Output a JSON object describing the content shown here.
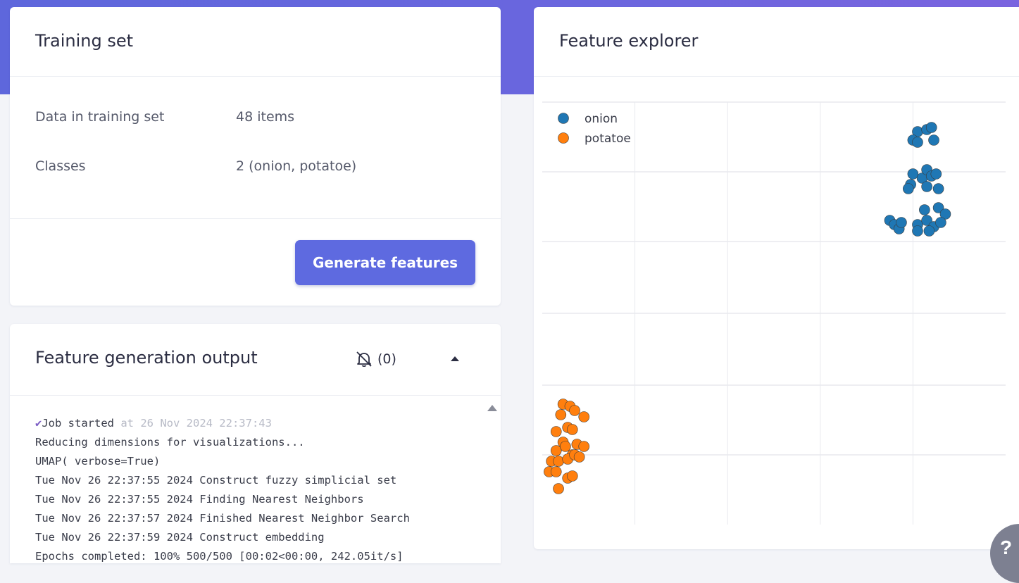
{
  "training": {
    "title": "Training set",
    "rows": [
      {
        "label": "Data in training set",
        "value": "48 items"
      },
      {
        "label": "Classes",
        "value": "2 (onion, potatoe)"
      }
    ],
    "generate_button": "Generate features"
  },
  "output": {
    "title": "Feature generation output",
    "notification_count": "(0)",
    "log": [
      {
        "text": "Job started",
        "time": " at 26 Nov 2024 22:37:43",
        "checked": true
      },
      {
        "text": "Reducing dimensions for visualizations..."
      },
      {
        "text": "UMAP( verbose=True)"
      },
      {
        "text": "Tue Nov 26 22:37:55 2024 Construct fuzzy simplicial set"
      },
      {
        "text": "Tue Nov 26 22:37:55 2024 Finding Nearest Neighbors"
      },
      {
        "text": "Tue Nov 26 22:37:57 2024 Finished Nearest Neighbor Search"
      },
      {
        "text": "Tue Nov 26 22:37:59 2024 Construct embedding"
      },
      {
        "text": "Epochs completed: 100% 500/500 [00:02<00:00, 242.05it/s]"
      }
    ]
  },
  "explorer": {
    "title": "Feature explorer"
  },
  "help": {
    "label": "?"
  },
  "colors": {
    "onion": "#1f77b4",
    "potatoe": "#ff7f0e",
    "accent": "#5e6ae0"
  },
  "chart_data": {
    "type": "scatter",
    "title": "",
    "xlabel": "",
    "ylabel": "",
    "xlim": [
      0,
      10
    ],
    "ylim": [
      0,
      10
    ],
    "grid": true,
    "legend_position": "top-left",
    "series": [
      {
        "name": "onion",
        "color": "#1f77b4",
        "points": [
          [
            8.1,
            9.3
          ],
          [
            8.3,
            9.35
          ],
          [
            8.4,
            9.4
          ],
          [
            8.0,
            9.1
          ],
          [
            8.1,
            9.05
          ],
          [
            8.45,
            9.1
          ],
          [
            8.0,
            8.3
          ],
          [
            8.2,
            8.2
          ],
          [
            8.3,
            8.4
          ],
          [
            8.4,
            8.25
          ],
          [
            8.5,
            8.3
          ],
          [
            7.95,
            8.05
          ],
          [
            7.9,
            7.95
          ],
          [
            8.3,
            8.0
          ],
          [
            8.55,
            7.95
          ],
          [
            8.25,
            7.45
          ],
          [
            8.55,
            7.5
          ],
          [
            8.7,
            7.35
          ],
          [
            7.5,
            7.2
          ],
          [
            7.6,
            7.1
          ],
          [
            7.7,
            7.0
          ],
          [
            8.1,
            7.1
          ],
          [
            8.3,
            7.2
          ],
          [
            8.45,
            7.05
          ],
          [
            8.1,
            6.95
          ],
          [
            8.35,
            6.95
          ],
          [
            7.75,
            7.15
          ],
          [
            8.6,
            7.15
          ]
        ]
      },
      {
        "name": "potatoe",
        "color": "#ff7f0e",
        "points": [
          [
            0.45,
            2.85
          ],
          [
            0.6,
            2.8
          ],
          [
            0.4,
            2.6
          ],
          [
            0.7,
            2.7
          ],
          [
            0.9,
            2.55
          ],
          [
            0.55,
            2.3
          ],
          [
            0.65,
            2.25
          ],
          [
            0.3,
            2.2
          ],
          [
            0.45,
            1.95
          ],
          [
            0.75,
            1.9
          ],
          [
            0.3,
            1.75
          ],
          [
            0.9,
            1.85
          ],
          [
            0.5,
            1.85
          ],
          [
            0.65,
            1.65
          ],
          [
            0.2,
            1.5
          ],
          [
            0.35,
            1.5
          ],
          [
            0.55,
            1.55
          ],
          [
            0.7,
            1.65
          ],
          [
            0.15,
            1.25
          ],
          [
            0.3,
            1.25
          ],
          [
            0.55,
            1.1
          ],
          [
            0.65,
            1.15
          ],
          [
            0.35,
            0.85
          ],
          [
            0.8,
            1.6
          ]
        ]
      }
    ]
  }
}
